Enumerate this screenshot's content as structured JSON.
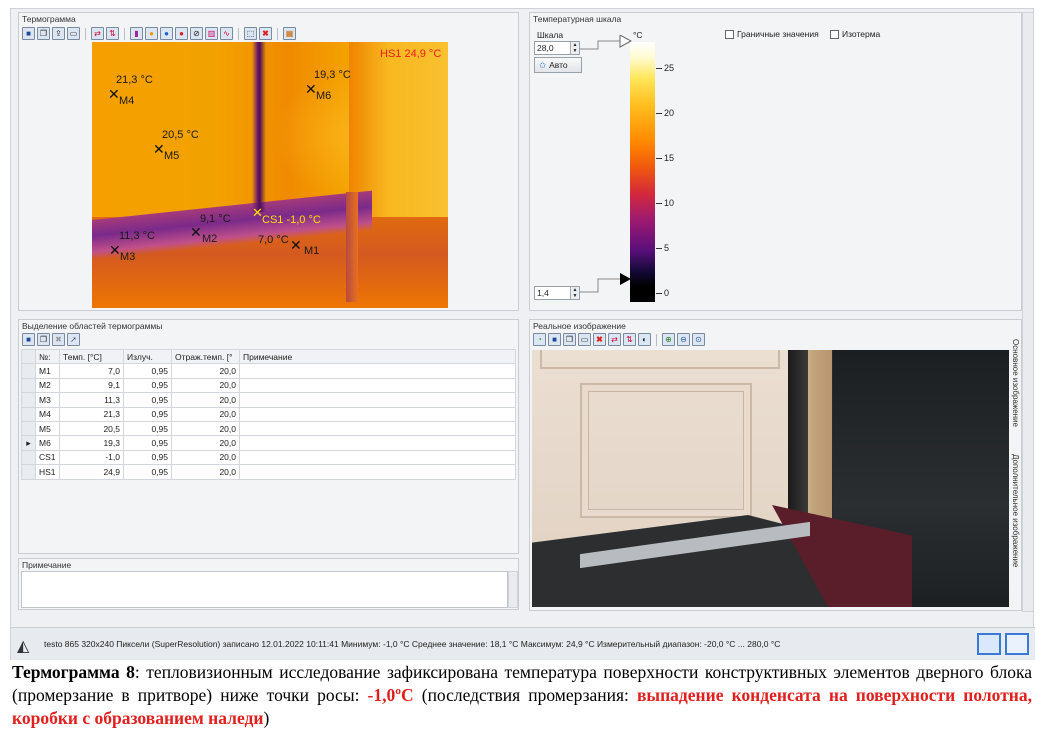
{
  "thermogram_panel": {
    "title": "Термограмма"
  },
  "thermogram": {
    "hotspot": "HS1 24,9 °C",
    "coldspot": "CS1 -1,0 °C",
    "markers": [
      {
        "label": "M1",
        "temp": "7,0 °C"
      },
      {
        "label": "M2",
        "temp": "9,1 °C"
      },
      {
        "label": "M3",
        "temp": "11,3 °C"
      },
      {
        "label": "M4",
        "temp": "21,3 °C"
      },
      {
        "label": "M5",
        "temp": "20,5 °C"
      },
      {
        "label": "M6",
        "temp": "19,3 °C"
      }
    ]
  },
  "scale_panel": {
    "title": "Температурная шкала",
    "scale_label": "Шкала",
    "max_value": "28,0",
    "min_value": "1,4",
    "auto_button": "Авто",
    "unit": "°C",
    "ticks": [
      "25",
      "20",
      "15",
      "10",
      "5",
      "0"
    ],
    "limits_checkbox": "Граничные значения",
    "isotherm_checkbox": "Изотерма"
  },
  "regions_panel": {
    "title": "Выделение областей термограммы",
    "columns": [
      "№:",
      "Темп. [°C]",
      "Излуч.",
      "Отраж.темп. [°",
      "Примечание"
    ],
    "rows": [
      {
        "id": "M1",
        "temp": "7,0",
        "emis": "0,95",
        "refl": "20,0",
        "note": ""
      },
      {
        "id": "M2",
        "temp": "9,1",
        "emis": "0,95",
        "refl": "20,0",
        "note": ""
      },
      {
        "id": "M3",
        "temp": "11,3",
        "emis": "0,95",
        "refl": "20,0",
        "note": ""
      },
      {
        "id": "M4",
        "temp": "21,3",
        "emis": "0,95",
        "refl": "20,0",
        "note": ""
      },
      {
        "id": "M5",
        "temp": "20,5",
        "emis": "0,95",
        "refl": "20,0",
        "note": ""
      },
      {
        "id": "M6",
        "temp": "19,3",
        "emis": "0,95",
        "refl": "20,0",
        "note": ""
      },
      {
        "id": "CS1",
        "temp": "-1,0",
        "emis": "0,95",
        "refl": "20,0",
        "note": ""
      },
      {
        "id": "HS1",
        "temp": "24,9",
        "emis": "0,95",
        "refl": "20,0",
        "note": ""
      }
    ]
  },
  "note_panel": {
    "title": "Примечание"
  },
  "real_panel": {
    "title": "Реальное изображение",
    "tab_main": "Основное изображение",
    "tab_extra": "Дополнительное изображение"
  },
  "status": {
    "text": "testo 865 320x240 Пиксели (SuperResolution) записано 12.01.2022 10:11:41  Минимум: -1,0 °C  Среднее значение: 18,1 °C  Максимум: 24,9 °C  Измерительный диапазон: -20,0 °C ... 280,0 °C"
  },
  "caption": {
    "part1": "Термограмма  8",
    "part2": ": тепловизионным исследование зафиксирована температура поверхности конструктивных элементов дверного блока (промерзание в притворе) ниже точки росы: ",
    "temp": "-1,0ºС",
    "part3": " (последствия промерзания: ",
    "consequence": "выпадение конденсата на поверхности полотна, коробки с образованием наледи",
    "part4": ")"
  }
}
